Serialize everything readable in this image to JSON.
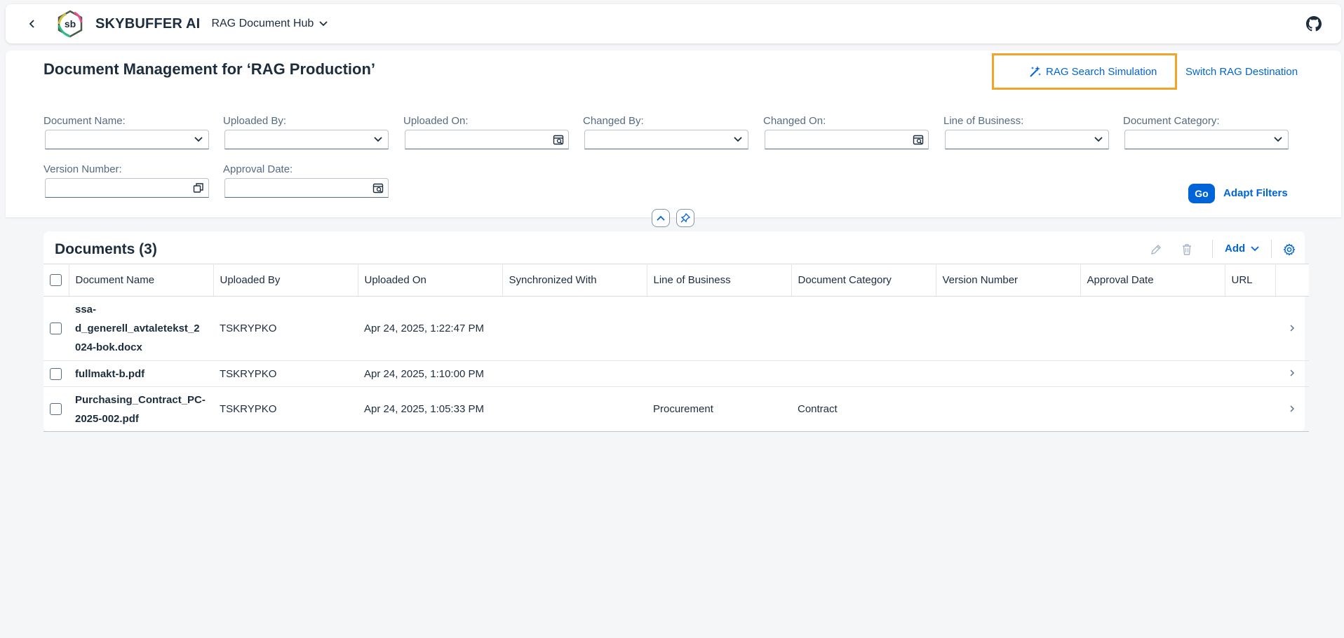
{
  "shell": {
    "brand": "SKYBUFFER AI",
    "logo_text": "sb",
    "app_title": "RAG Document Hub"
  },
  "page": {
    "title": "Document Management for ‘RAG Production’",
    "actions": {
      "search_simulation": "RAG Search Simulation",
      "switch_destination": "Switch RAG Destination"
    }
  },
  "filters": {
    "document_name": "Document Name:",
    "uploaded_by": "Uploaded By:",
    "uploaded_on": "Uploaded On:",
    "changed_by": "Changed By:",
    "changed_on": "Changed On:",
    "line_of_business": "Line of Business:",
    "document_category": "Document Category:",
    "version_number": "Version Number:",
    "approval_date": "Approval Date:",
    "go": "Go",
    "adapt": "Adapt Filters"
  },
  "table": {
    "title": "Documents (3)",
    "add_label": "Add",
    "columns": [
      "Document Name",
      "Uploaded By",
      "Uploaded On",
      "Synchronized With",
      "Line of Business",
      "Document Category",
      "Version Number",
      "Approval Date",
      "URL"
    ],
    "rows": [
      {
        "name": "ssa-d_generell_avtaletekst_2024-bok.docx",
        "name_lines": [
          "ssa-",
          "d_generell_avtaletekst_2",
          "024-bok.docx"
        ],
        "uploaded_by": "TSKRYPKO",
        "uploaded_on": "Apr 24, 2025, 1:22:47 PM",
        "synchronized_with": "",
        "line_of_business": "",
        "document_category": "",
        "version_number": "",
        "approval_date": "",
        "url": ""
      },
      {
        "name": "fullmakt-b.pdf",
        "name_lines": [
          "fullmakt-b.pdf"
        ],
        "uploaded_by": "TSKRYPKO",
        "uploaded_on": "Apr 24, 2025, 1:10:00 PM",
        "synchronized_with": "",
        "line_of_business": "",
        "document_category": "",
        "version_number": "",
        "approval_date": "",
        "url": ""
      },
      {
        "name": "Purchasing_Contract_PC-2025-002.pdf",
        "name_lines": [
          "Purchasing_Contract_PC-",
          "2025-002.pdf"
        ],
        "uploaded_by": "TSKRYPKO",
        "uploaded_on": "Apr 24, 2025, 1:05:33 PM",
        "synchronized_with": "",
        "line_of_business": "Procurement",
        "document_category": "Contract",
        "version_number": "",
        "approval_date": "",
        "url": ""
      }
    ]
  },
  "colors": {
    "accent": "#0064d9",
    "highlight": "#f0a52a",
    "text": "#1d2d3e",
    "label": "#556b82"
  },
  "icons": {
    "back": "chevron-left-icon",
    "title_menu": "chevron-down-icon",
    "github": "github-icon",
    "simulation": "sparkle-icon",
    "dropdown": "chevron-down-icon",
    "date": "calendar-icon",
    "value_help": "value-help-icon",
    "collapse": "chevron-up-icon",
    "pin": "pin-icon",
    "edit": "pencil-icon",
    "delete": "trash-icon",
    "settings": "gear-icon",
    "row_nav": "chevron-right-icon"
  }
}
